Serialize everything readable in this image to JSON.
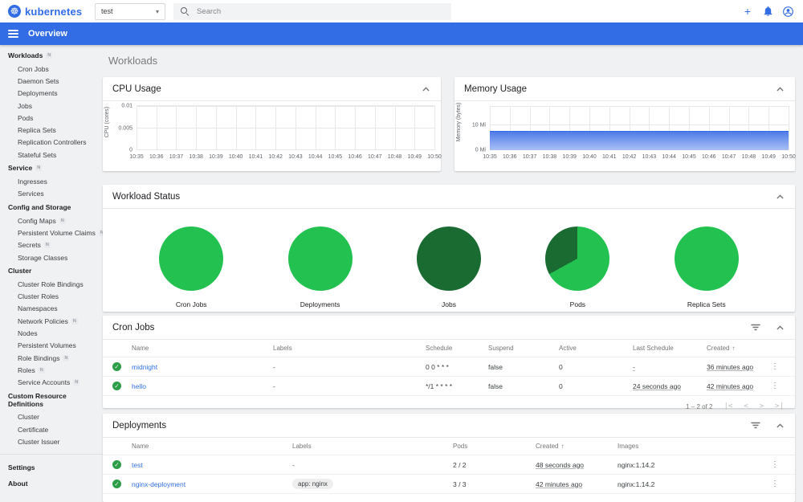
{
  "topbar": {
    "logo_text": "kubernetes",
    "logo_icon": "kubernetes-helm-wheel",
    "namespace": {
      "value": "test"
    },
    "search": {
      "placeholder": "Search"
    },
    "actions": [
      {
        "name": "create-new",
        "icon": "plus-icon",
        "glyph": "+"
      },
      {
        "name": "notifications",
        "icon": "bell-icon",
        "glyph": "🔔"
      },
      {
        "name": "user",
        "icon": "user-icon",
        "glyph": "👤"
      }
    ]
  },
  "appbar": {
    "title": "Overview"
  },
  "sidebar": {
    "sections": [
      {
        "label": "Workloads",
        "badge": "N",
        "items": [
          {
            "label": "Cron Jobs"
          },
          {
            "label": "Daemon Sets"
          },
          {
            "label": "Deployments"
          },
          {
            "label": "Jobs"
          },
          {
            "label": "Pods"
          },
          {
            "label": "Replica Sets"
          },
          {
            "label": "Replication Controllers"
          },
          {
            "label": "Stateful Sets"
          }
        ]
      },
      {
        "label": "Service",
        "badge": "N",
        "items": [
          {
            "label": "Ingresses"
          },
          {
            "label": "Services"
          }
        ]
      },
      {
        "label": "Config and Storage",
        "items": [
          {
            "label": "Config Maps",
            "badge": "N"
          },
          {
            "label": "Persistent Volume Claims",
            "badge": "N"
          },
          {
            "label": "Secrets",
            "badge": "N"
          },
          {
            "label": "Storage Classes"
          }
        ]
      },
      {
        "label": "Cluster",
        "items": [
          {
            "label": "Cluster Role Bindings"
          },
          {
            "label": "Cluster Roles"
          },
          {
            "label": "Namespaces"
          },
          {
            "label": "Network Policies",
            "badge": "N"
          },
          {
            "label": "Nodes"
          },
          {
            "label": "Persistent Volumes"
          },
          {
            "label": "Role Bindings",
            "badge": "N"
          },
          {
            "label": "Roles",
            "badge": "N"
          },
          {
            "label": "Service Accounts",
            "badge": "N"
          }
        ]
      },
      {
        "label": "Custom Resource Definitions",
        "items": [
          {
            "label": "Cluster"
          },
          {
            "label": "Certificate"
          },
          {
            "label": "Cluster Issuer"
          }
        ]
      }
    ],
    "footer_items": [
      {
        "label": "Settings"
      },
      {
        "label": "About"
      }
    ]
  },
  "page": {
    "title": "Workloads"
  },
  "colors": {
    "brand_blue": "#326de6",
    "link_blue": "#3270e2",
    "green_bright": "#22c150",
    "green_dark": "#1a6b32",
    "check_green": "#2d9e47",
    "area_blue_top": "#4f7ce8",
    "area_blue_bottom": "#a9c0f4"
  },
  "chart_data": [
    {
      "id": "cpu",
      "type": "line",
      "title": "CPU Usage",
      "ylabel": "CPU (cores)",
      "ylim": [
        0,
        0.01
      ],
      "yticks": [
        {
          "label": "0",
          "value": 0
        },
        {
          "label": "0.005",
          "value": 0.005
        },
        {
          "label": "0.01",
          "value": 0.01
        }
      ],
      "x": [
        "10:35",
        "10:36",
        "10:37",
        "10:38",
        "10:39",
        "10:40",
        "10:41",
        "10:42",
        "10:43",
        "10:44",
        "10:45",
        "10:46",
        "10:47",
        "10:48",
        "10:49",
        "10:50"
      ],
      "series": []
    },
    {
      "id": "memory",
      "type": "area",
      "title": "Memory Usage",
      "ylabel": "Memory (bytes)",
      "ylim": [
        0,
        17.5
      ],
      "unit": "Mi",
      "yticks": [
        {
          "label": "0 Mi",
          "value": 0
        },
        {
          "label": "10 Mi",
          "value": 10
        }
      ],
      "x": [
        "10:35",
        "10:36",
        "10:37",
        "10:38",
        "10:39",
        "10:40",
        "10:41",
        "10:42",
        "10:43",
        "10:44",
        "10:45",
        "10:46",
        "10:47",
        "10:48",
        "10:49",
        "10:50"
      ],
      "series": [
        {
          "name": "memory usage",
          "values": [
            7.5,
            7.5,
            7.5,
            7.5,
            7.5,
            7.5,
            7.5,
            7.5,
            7.5,
            7.5,
            7.5,
            7.5,
            7.5,
            7.5,
            7.5,
            7.5
          ]
        }
      ]
    },
    {
      "id": "workload-status",
      "type": "pie",
      "title": "Workload Status",
      "pies": [
        {
          "label": "Cron Jobs",
          "segments": [
            {
              "color": "#22c150",
              "pct": 100
            }
          ]
        },
        {
          "label": "Deployments",
          "segments": [
            {
              "color": "#22c150",
              "pct": 100
            }
          ]
        },
        {
          "label": "Jobs",
          "segments": [
            {
              "color": "#1a6b32",
              "pct": 100
            }
          ]
        },
        {
          "label": "Pods",
          "segments": [
            {
              "color": "#22c150",
              "pct": 67
            },
            {
              "color": "#1a6b32",
              "pct": 33
            }
          ]
        },
        {
          "label": "Replica Sets",
          "segments": [
            {
              "color": "#22c150",
              "pct": 100
            }
          ]
        }
      ]
    }
  ],
  "cron_jobs_table": {
    "title": "Cron Jobs",
    "columns": [
      "Name",
      "Labels",
      "Schedule",
      "Suspend",
      "Active",
      "Last Schedule",
      "Created"
    ],
    "sorted_column": "Created",
    "rows": [
      {
        "status_icon": "check-circle",
        "name": "midnight",
        "labels": "-",
        "schedule": "0 0 * * *",
        "suspend": "false",
        "active": "0",
        "last_schedule": "-",
        "created": "36 minutes ago"
      },
      {
        "status_icon": "check-circle",
        "name": "hello",
        "labels": "-",
        "schedule": "*/1 * * * *",
        "suspend": "false",
        "active": "0",
        "last_schedule": "24 seconds ago",
        "created": "42 minutes ago"
      }
    ],
    "pagination": {
      "label": "1 – 2 of 2"
    }
  },
  "deployments_table": {
    "title": "Deployments",
    "columns": [
      "Name",
      "Labels",
      "Pods",
      "Created",
      "Images"
    ],
    "sorted_column": "Created",
    "rows": [
      {
        "status_icon": "check-circle",
        "name": "test",
        "labels": "-",
        "labels_is_chip": false,
        "pods": "2 / 2",
        "created": "48 seconds ago",
        "images": "nginx:1.14.2"
      },
      {
        "status_icon": "check-circle",
        "name": "nginx-deployment",
        "labels": "app: nginx",
        "labels_is_chip": true,
        "pods": "3 / 3",
        "created": "42 minutes ago",
        "images": "nginx:1.14.2"
      }
    ]
  }
}
